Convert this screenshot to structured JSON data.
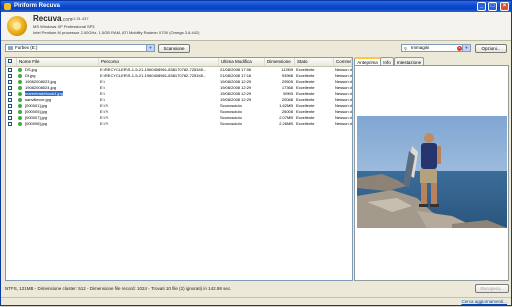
{
  "window": {
    "title": "Piriform Recuva",
    "min_glyph": "_",
    "max_glyph": "□",
    "close_glyph": "×"
  },
  "header": {
    "brand": "Recuva",
    "brand_suffix": ".com",
    "version": "v1.31.437",
    "system_line1": "MS Windows XP Professional SP3",
    "system_line2": "Intel Pentium M processor 2.00GHz, 1,5GB RAM, ATI Mobility Radeon X700 (Omega 3.8.442)"
  },
  "toolbar": {
    "drive_value": "Furbex (E:)",
    "scan_label": "Scansione",
    "filter_value": "Immagini",
    "options_label": "Opzioni...",
    "filter_icon": "magnifier-icon"
  },
  "table": {
    "columns": [
      "",
      "Nome File",
      "Percorso",
      "Ultima Modifica",
      "Dimensione",
      "Stato",
      "Commento"
    ],
    "rows": [
      {
        "status_color": "#3cae3c",
        "name": "DS.jpg",
        "path": "E:\\RECYCLER\\S-1-5-21-1960408961-838170782-725345...",
        "modified": "21/08/2008 17:06",
        "size": "113KB",
        "state": "Eccellente",
        "comment": "Nessun du"
      },
      {
        "status_color": "#3cae3c",
        "name": "Df.jpg",
        "path": "E:\\RECYCLER\\S-1-5-21-1960408961-838170782-725345...",
        "modified": "21/08/2008 17:16",
        "size": "93968",
        "state": "Eccellente",
        "comment": "Nessun du"
      },
      {
        "status_color": "#3cae3c",
        "name": "19082008023.jpg",
        "path": "E:\\",
        "modified": "19/08/2008 12:29",
        "size": "29505",
        "state": "Eccellente",
        "comment": "Nessun du"
      },
      {
        "status_color": "#3cae3c",
        "name": "19082008024.jpg",
        "path": "E:\\",
        "modified": "19/08/2008 12:29",
        "size": "17368",
        "state": "Eccellente",
        "comment": "Nessun du"
      },
      {
        "status_color": "#3cae3c",
        "name": "mareetradebook4.jpg",
        "path": "E:\\",
        "modified": "19/08/2008 12:29",
        "size": "59KB",
        "state": "Eccellente",
        "comment": "Nessun du",
        "selected": true
      },
      {
        "status_color": "#3cae3c",
        "name": "sanvillecce.jpg",
        "path": "E:\\",
        "modified": "19/08/2008 12:29",
        "size": "20068",
        "state": "Eccellente",
        "comment": "Nessun du"
      },
      {
        "status_color": "#3cae3c",
        "name": "[000001].jpg",
        "path": "E:\\?\\",
        "modified": "Sconosciuto",
        "size": "1.62MB",
        "state": "Eccellente",
        "comment": "Nessun du"
      },
      {
        "status_color": "#3cae3c",
        "name": "[000005].jpg",
        "path": "E:\\?\\",
        "modified": "Sconosciuto",
        "size": "25008",
        "state": "Eccellente",
        "comment": "Nessun du"
      },
      {
        "status_color": "#3cae3c",
        "name": "[000007].jpg",
        "path": "E:\\?\\",
        "modified": "Sconosciuto",
        "size": "2.07MB",
        "state": "Eccellente",
        "comment": "Nessun du"
      },
      {
        "status_color": "#3cae3c",
        "name": "[000008].jpg",
        "path": "E:\\?\\",
        "modified": "Sconosciuto",
        "size": "2.26MB",
        "state": "Eccellente",
        "comment": "Nessun du"
      }
    ]
  },
  "preview": {
    "tabs": [
      "Anteprima",
      "Info",
      "Intestazione"
    ],
    "active_tab": "Anteprima"
  },
  "footer": {
    "status": "NTFS, 121MB - Dimensione cluster: 512 - Dimensione file record: 1024 - Trovati 10 file (2) ignorati) in 142.98 sec.",
    "recover_label": "Recupera...",
    "update_link": "Cerca aggiornamenti..."
  }
}
